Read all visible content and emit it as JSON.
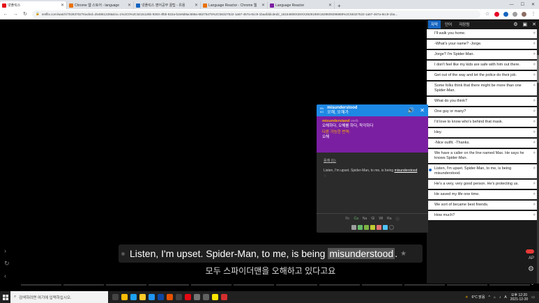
{
  "browser": {
    "tabs": [
      {
        "title": "넷플릭스",
        "color": "#e50914",
        "active": true
      },
      {
        "title": "Chrome 웹 스토어 - language",
        "color": "#e8710a",
        "active": false
      },
      {
        "title": "넷플릭스 영어공부 꿀팁 - 유용",
        "color": "#1565c0",
        "active": false
      },
      {
        "title": "Language Reactor - Chrome 웹",
        "color": "#e8710a",
        "active": false
      },
      {
        "title": "Language Reactor",
        "color": "#7b1fa2",
        "active": false
      }
    ],
    "url": "netflix.com/watch/70293702?trackId=254861228&tctx=1%2C0%2C6415126b-9303-4f5b-922a-b2e8d8ac688a-68275475%2C55327522-1a67-467a-8cc9-1baafddcded2_18154808X28XX2929198X1639609296888%2C55327522-1a67-467a-8cc9-1ba..."
  },
  "sidebar": {
    "tabs": [
      "자막",
      "단어",
      "저장됨"
    ],
    "subtitles": [
      {
        "text": "I'll walk you home."
      },
      {
        "text": "-What's your name? -Jorge."
      },
      {
        "text": "Jorge? I'm Spider-Man."
      },
      {
        "text": "I don't feel like my kids are safe with him out there."
      },
      {
        "text": "Get out of the way and let the police do their job."
      },
      {
        "text": "Some folks think that there might be more than one Spider-Man."
      },
      {
        "text": "What do you think?"
      },
      {
        "text": "One guy or many?"
      },
      {
        "text": "I'd love to know who's behind that mask."
      },
      {
        "text": "Hey."
      },
      {
        "text": "-Nice outfit. -Thanks."
      },
      {
        "text": "We have a caller on the line named Max. He says he knows Spider-Man."
      },
      {
        "text": "Listen, I'm upset. Spider-Man, to me, is being misunderstood.",
        "current": true
      },
      {
        "text": "He's a very, very good person. He's protecting us."
      },
      {
        "text": "He saved my life one time."
      },
      {
        "text": "We sort of became best friends."
      },
      {
        "text": "How much?"
      }
    ]
  },
  "popup": {
    "flag_top": "EN",
    "flag_bottom": "KO",
    "word": "misunderstood",
    "translation": "오해, 오해가",
    "pos_word": "misunderstand",
    "pos_tag": "verb",
    "definition": "오해하다, 오해를 하다, 착각하다",
    "alt_head": "다른 가능한 번역:",
    "alt_def": "오해",
    "example_head": "용례 (1):",
    "example_pre": "Listen, I'm upset. Spider-Man, to me, is being",
    "example_word": "misunderstood",
    "levels": [
      {
        "label": "Rc",
        "color": "#888888"
      },
      {
        "label": "Ca",
        "color": "#66bb6a"
      },
      {
        "label": "Na",
        "color": "#9e9e9e"
      },
      {
        "label": "Gl",
        "color": "#9e9e9e"
      },
      {
        "label": "Wl",
        "color": "#9e9e9e"
      },
      {
        "label": "Ra",
        "color": "#9e9e9e"
      }
    ],
    "swatches": [
      "#9e9e9e",
      "#66bb6a",
      "#7cb342",
      "#c0ca33",
      "#e57373",
      "#4fc3f7"
    ]
  },
  "player": {
    "subtitle_pre": "Listen, I'm upset. Spider-Man, to me, is being",
    "subtitle_word": "misunderstood",
    "subtitle_post": ".",
    "translation": "모두 스파이더맨을 오해하고 있다고요",
    "ap_label": "AP"
  },
  "taskbar": {
    "search_placeholder": "검색하려면 여기에 입력하십시오.",
    "weather": "6°C 맑음",
    "ime": "A",
    "time": "오후 12:20",
    "date": "2021-12-20"
  }
}
